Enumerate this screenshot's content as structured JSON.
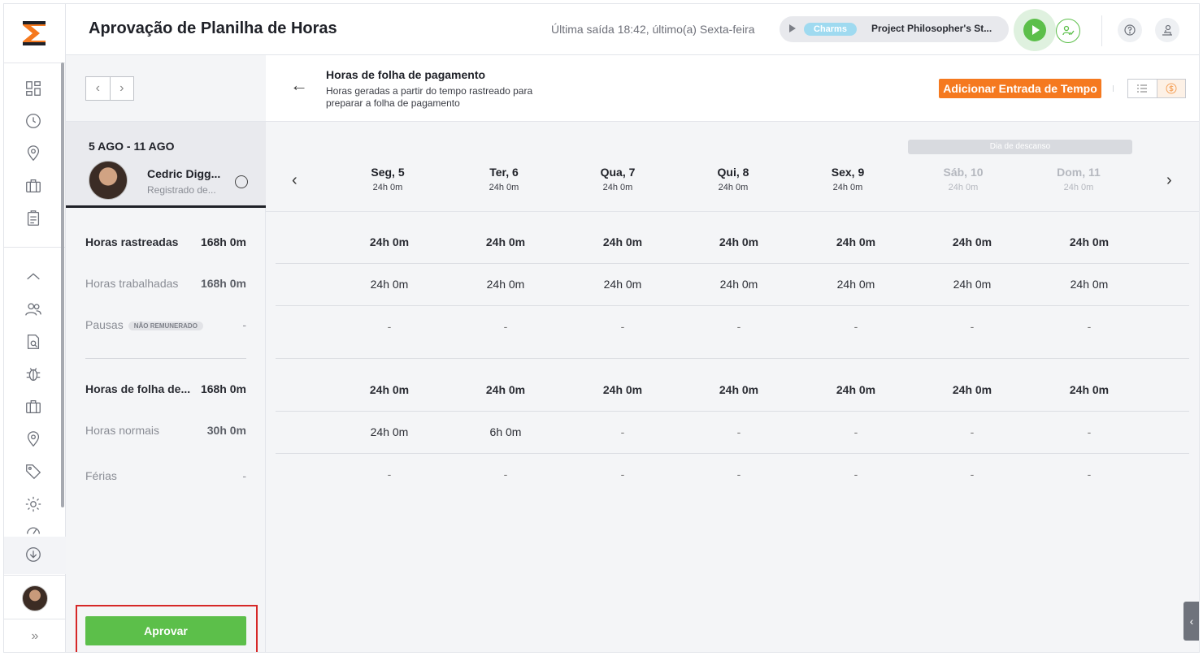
{
  "header": {
    "title": "Aprovação de Planilha de Horas",
    "last_exit": "Última saída 18:42, último(a) Sexta-feira",
    "timer_tag": "Charms",
    "timer_project": "Project Philosopher's St..."
  },
  "week_nav": {
    "prev": "‹",
    "next": "›"
  },
  "week_card": {
    "range": "5 AGO - 11 AGO",
    "name": "Cedric Digg...",
    "status": "Registrado de..."
  },
  "summary": {
    "tracked": {
      "label": "Horas rastreadas",
      "value": "168h 0m"
    },
    "worked": {
      "label": "Horas trabalhadas",
      "value": "168h 0m"
    },
    "breaks": {
      "label": "Pausas",
      "badge": "NÃO REMUNERADO",
      "value": "-"
    },
    "payroll": {
      "label": "Horas de folha de...",
      "value": "168h 0m"
    },
    "regular": {
      "label": "Horas normais",
      "value": "30h 0m"
    },
    "vacation": {
      "label": "Férias",
      "value": "-"
    }
  },
  "approve_label": "Aprovar",
  "main_head": {
    "title": "Horas de folha de pagamento",
    "subtitle": "Horas geradas a partir do tempo rastreado para preparar a folha de pagamento",
    "add_entry": "Adicionar Entrada de Tempo"
  },
  "rest_day_label": "Dia de descanso",
  "days": [
    {
      "name": "Seg, 5",
      "total": "24h 0m",
      "off": false
    },
    {
      "name": "Ter, 6",
      "total": "24h 0m",
      "off": false
    },
    {
      "name": "Qua, 7",
      "total": "24h 0m",
      "off": false
    },
    {
      "name": "Qui, 8",
      "total": "24h 0m",
      "off": false
    },
    {
      "name": "Sex, 9",
      "total": "24h 0m",
      "off": false
    },
    {
      "name": "Sáb, 10",
      "total": "24h 0m",
      "off": true
    },
    {
      "name": "Dom, 11",
      "total": "24h 0m",
      "off": true
    }
  ],
  "rows": [
    {
      "id": "tracked",
      "bold": true,
      "cells": [
        "24h 0m",
        "24h 0m",
        "24h 0m",
        "24h 0m",
        "24h 0m",
        "24h 0m",
        "24h 0m"
      ]
    },
    {
      "id": "worked",
      "bold": false,
      "cells": [
        "24h 0m",
        "24h 0m",
        "24h 0m",
        "24h 0m",
        "24h 0m",
        "24h 0m",
        "24h 0m"
      ]
    },
    {
      "id": "breaks",
      "bold": false,
      "cells": [
        "-",
        "-",
        "-",
        "-",
        "-",
        "-",
        "-"
      ]
    },
    {
      "id": "payroll",
      "bold": true,
      "cells": [
        "24h 0m",
        "24h 0m",
        "24h 0m",
        "24h 0m",
        "24h 0m",
        "24h 0m",
        "24h 0m"
      ]
    },
    {
      "id": "regular",
      "bold": false,
      "cells": [
        "24h 0m",
        "6h 0m",
        "-",
        "-",
        "-",
        "-",
        "-"
      ]
    },
    {
      "id": "vacation",
      "bold": false,
      "cells": [
        "-",
        "-",
        "-",
        "-",
        "-",
        "-",
        "-"
      ]
    }
  ],
  "colors": {
    "accent": "#f5791f",
    "approve": "#5cbf4a",
    "highlight": "#d62828"
  }
}
